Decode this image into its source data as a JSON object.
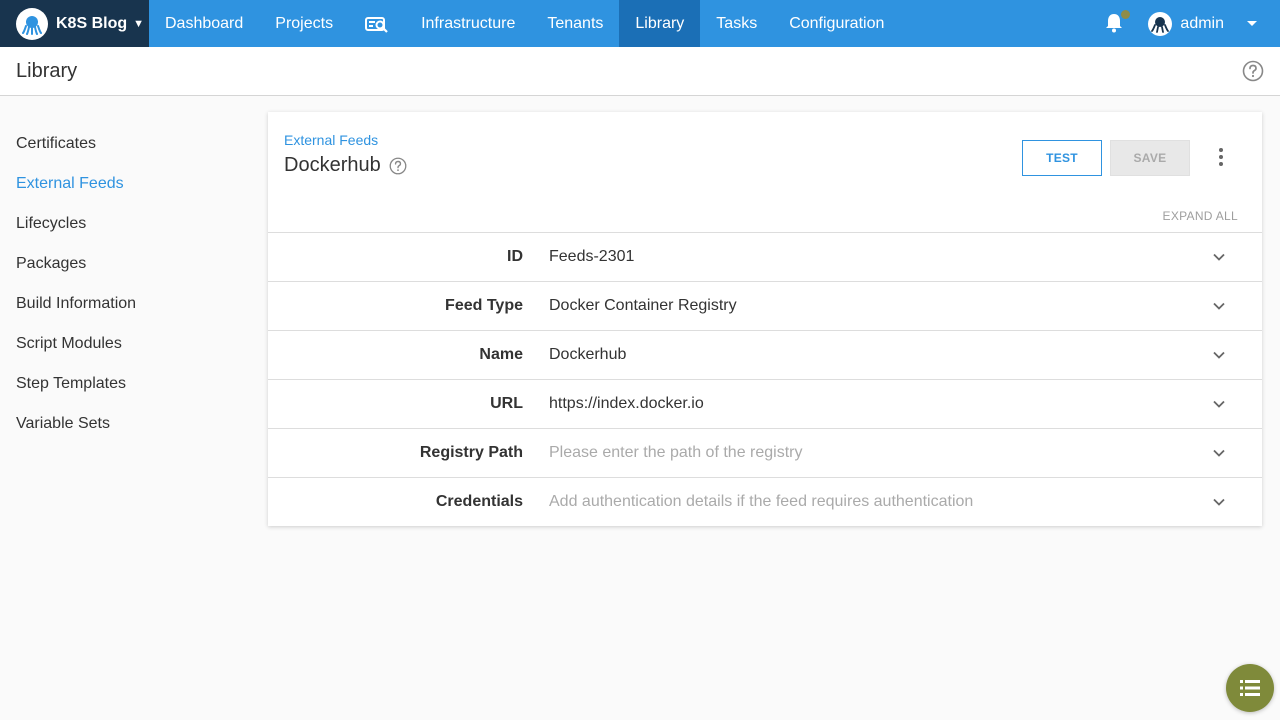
{
  "topnav": {
    "space_name": "K8S Blog",
    "items": [
      {
        "label": "Dashboard"
      },
      {
        "label": "Projects"
      },
      {
        "label": "Infrastructure"
      },
      {
        "label": "Tenants"
      },
      {
        "label": "Library"
      },
      {
        "label": "Tasks"
      },
      {
        "label": "Configuration"
      }
    ],
    "active": "Library",
    "user": "admin",
    "colors": {
      "bar": "#2f93e0",
      "active": "#1b6fb6",
      "space": "#18344e"
    }
  },
  "header": {
    "title": "Library"
  },
  "sidebar": {
    "items": [
      {
        "label": "Certificates"
      },
      {
        "label": "External Feeds"
      },
      {
        "label": "Lifecycles"
      },
      {
        "label": "Packages"
      },
      {
        "label": "Build Information"
      },
      {
        "label": "Script Modules"
      },
      {
        "label": "Step Templates"
      },
      {
        "label": "Variable Sets"
      }
    ],
    "active": "External Feeds"
  },
  "card": {
    "breadcrumb": "External Feeds",
    "title": "Dockerhub",
    "test_label": "TEST",
    "save_label": "SAVE",
    "expand_all": "EXPAND ALL",
    "rows": [
      {
        "label": "ID",
        "value": "Feeds-2301"
      },
      {
        "label": "Feed Type",
        "value": "Docker Container Registry"
      },
      {
        "label": "Name",
        "value": "Dockerhub"
      },
      {
        "label": "URL",
        "value": "https://index.docker.io"
      },
      {
        "label": "Registry Path",
        "placeholder": "Please enter the path of the registry"
      },
      {
        "label": "Credentials",
        "placeholder": "Add authentication details if the feed requires authentication"
      }
    ]
  },
  "icons": {
    "space_logo": "octopus-logo-icon",
    "search": "search-icon",
    "bell": "bell-icon",
    "avatar": "user-avatar-icon",
    "help": "help-circle-icon",
    "chevron": "chevron-down-icon",
    "more": "more-vert-icon",
    "fab": "list-icon"
  }
}
